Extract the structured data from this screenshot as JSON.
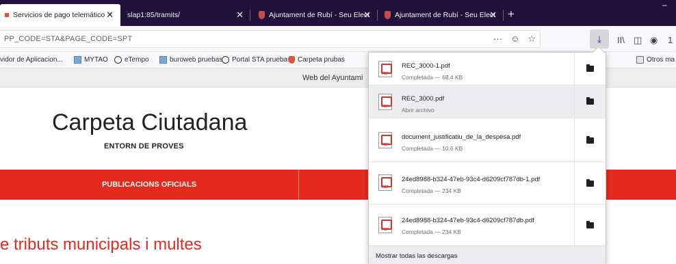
{
  "tabs": [
    {
      "title": "Servicios de pago telemático",
      "close": "✕"
    },
    {
      "title": "slap1:85/tramits/",
      "close": "✕"
    },
    {
      "title": "Ajuntament de Rubí - Seu Elect",
      "close": "✕"
    },
    {
      "title": "Ajuntament de Rubí - Seu Elect",
      "close": "✕"
    }
  ],
  "new_tab": "+",
  "window_control": "–",
  "urlbar": {
    "url": "PP_CODE=STA&PAGE_CODE=SPT",
    "more": "···",
    "pocket": "☺",
    "star": "☆"
  },
  "toolbar": {
    "download": "⤓",
    "library": "II\\",
    "sidebar": "◫",
    "account": "◉",
    "overflow": "1"
  },
  "bookmarks": [
    {
      "label": "vidor de Aplicacion...",
      "icon": "none"
    },
    {
      "label": "MYTAO",
      "icon": "image-icon"
    },
    {
      "label": "eTempo",
      "icon": "globe-icon"
    },
    {
      "label": "buroweb pruebas",
      "icon": "image-icon"
    },
    {
      "label": "Portal STA pruebas",
      "icon": "globe-icon"
    },
    {
      "label": "Carpeta prubas",
      "icon": "shield-icon"
    },
    {
      "label": "Otros ma",
      "icon": "folder-icon"
    }
  ],
  "page": {
    "topbar_text": "Web del Ayuntami",
    "title": "Carpeta Ciutadana",
    "subtitle": "ENTORN DE PROVES",
    "menu": [
      "PUBLICACIONS OFICIALS"
    ],
    "section_title": "e tributs municipals i multes"
  },
  "downloads": {
    "items": [
      {
        "name": "REC_3000-1.pdf",
        "status": "Completada — 68,4 KB"
      },
      {
        "name": "REC_3000.pdf",
        "status": "Abrir archivo"
      },
      {
        "name": "document_justificatiu_de_la_despesa.pdf",
        "status": "Completada — 10,6 KB"
      },
      {
        "name": "24ed8988-b324-47eb-93c4-d6209cf787db-1.pdf",
        "status": "Completada — 234 KB"
      },
      {
        "name": "24ed8988-b324-47eb-93c4-d6209cf787db.pdf",
        "status": "Completada — 234 KB"
      }
    ],
    "show_all": "Mostrar todas las descargas"
  },
  "colors": {
    "tabstrip": "#20123a",
    "brand_red": "#e42a1f",
    "pdf_red": "#d8312b"
  }
}
